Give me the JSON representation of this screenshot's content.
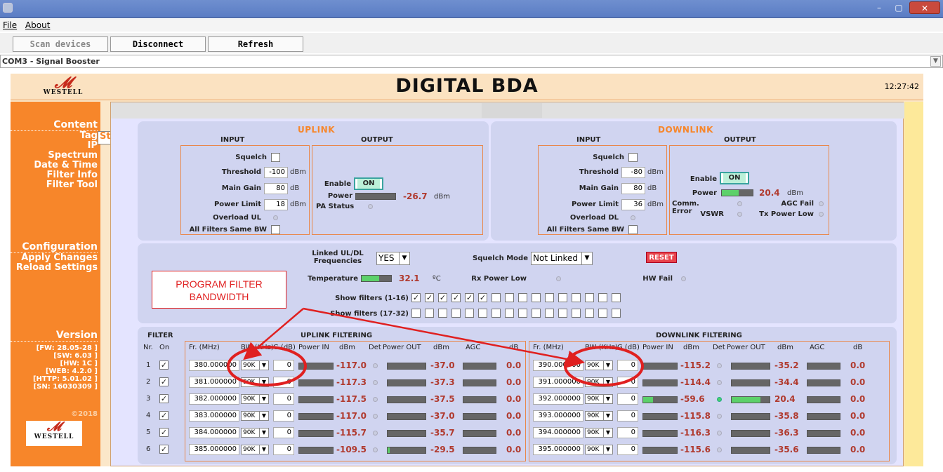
{
  "window": {
    "minimize": "–",
    "maximize": "▢",
    "close": "✕"
  },
  "menu": {
    "file": "File",
    "about": "About"
  },
  "toolbar": {
    "scan": "Scan devices",
    "disconnect": "Disconnect",
    "refresh": "Refresh"
  },
  "device": {
    "selected": "COM3 - Signal Booster"
  },
  "header": {
    "title": "DIGITAL BDA",
    "clock": "12:27:42",
    "logo": "WESTELL"
  },
  "sidebar": {
    "content_heading": "Content",
    "content_items": [
      "Status",
      "Tag",
      "IP",
      "Spectrum",
      "Date & Time",
      "Filter Info",
      "Filter Tool"
    ],
    "config_heading": "Configuration",
    "config_items": [
      "Apply Changes",
      "Reload Settings"
    ],
    "version_heading": "Version",
    "versions": [
      "[FW: 28.05-28 ]",
      "[SW: 6.03 ]",
      "[HW:  1C ]",
      "[WEB: 4.2.0 ]",
      "[HTTP: 5.01.02 ]",
      "[SN: 16030309 ]"
    ],
    "copyright": "©2018",
    "logo": "WESTELL"
  },
  "uplink": {
    "title": "UPLINK",
    "input": "INPUT",
    "output": "OUTPUT",
    "squelch": "Squelch",
    "threshold": "Threshold",
    "threshold_val": "-100",
    "threshold_unit": "dBm",
    "main_gain": "Main Gain",
    "main_gain_val": "80",
    "main_gain_unit": "dB",
    "power_limit": "Power Limit",
    "power_limit_val": "18",
    "power_limit_unit": "dBm",
    "overload": "Overload UL",
    "all_filters": "All Filters Same BW",
    "enable": "Enable",
    "on": "ON",
    "power": "Power",
    "power_val": "-26.7",
    "power_unit": "dBm",
    "pa_status": "PA Status"
  },
  "downlink": {
    "title": "DOWNLINK",
    "input": "INPUT",
    "output": "OUTPUT",
    "squelch": "Squelch",
    "threshold": "Threshold",
    "threshold_val": "-80",
    "threshold_unit": "dBm",
    "main_gain": "Main Gain",
    "main_gain_val": "80",
    "main_gain_unit": "dB",
    "power_limit": "Power Limit",
    "power_limit_val": "36",
    "power_limit_unit": "dBm",
    "overload": "Overload DL",
    "all_filters": "All Filters Same BW",
    "enable": "Enable",
    "on": "ON",
    "power": "Power",
    "power_val": "20.4",
    "power_unit": "dBm",
    "power_level": 0.55,
    "comm_error": "Comm. Error",
    "agc_fail": "AGC Fail",
    "vswr": "VSWR",
    "tx_power_low": "Tx Power Low"
  },
  "config": {
    "linked_label_1": "Linked UL/DL",
    "linked_label_2": "Frequencies",
    "linked_val": "YES",
    "squelch_mode": "Squelch Mode",
    "squelch_mode_val": "Not Linked",
    "reset": "RESET",
    "temperature": "Temperature",
    "temperature_val": "32.1",
    "temperature_unit": "ºC",
    "temperature_level": 0.6,
    "rx_power_low": "Rx Power Low",
    "hw_fail": "HW Fail",
    "show_1_16": "Show filters (1-16)",
    "show_17_32": "Show filters (17-32)",
    "checked_1_16": 6
  },
  "callout": {
    "line1": "PROGRAM FILTER",
    "line2": "BANDWIDTH"
  },
  "filter": {
    "heading": "FILTER",
    "nr": "Nr.",
    "on": "On",
    "uplink_heading": "UPLINK FILTERING",
    "downlink_heading": "DOWNLINK FILTERING",
    "columns": {
      "fr": "Fr. (MHz)",
      "bw": "BW (KHz)",
      "g": "G (dB)",
      "power_in": "Power IN",
      "dbm": "dBm",
      "det": "Det",
      "power_out": "Power OUT",
      "dbm2": "dBm",
      "agc": "AGC",
      "db": "dB"
    },
    "rows": [
      {
        "nr": "1",
        "ul": {
          "fr": "380.000000",
          "bw": "90K",
          "g": "0",
          "pin": "-117.0",
          "pout": "-37.0",
          "agc": "0.0",
          "pin_level": 0,
          "pout_level": 0
        },
        "dl": {
          "fr": "390.000000",
          "bw": "90K",
          "g": "0",
          "pin": "-115.2",
          "pout": "-35.2",
          "agc": "0.0",
          "pin_level": 0,
          "pout_level": 0
        }
      },
      {
        "nr": "2",
        "ul": {
          "fr": "381.000000",
          "bw": "90K",
          "g": "0",
          "pin": "-117.3",
          "pout": "-37.3",
          "agc": "0.0",
          "pin_level": 0,
          "pout_level": 0
        },
        "dl": {
          "fr": "391.000000",
          "bw": "90K",
          "g": "0",
          "pin": "-114.4",
          "pout": "-34.4",
          "agc": "0.0",
          "pin_level": 0,
          "pout_level": 0
        }
      },
      {
        "nr": "3",
        "ul": {
          "fr": "382.000000",
          "bw": "90K",
          "g": "0",
          "pin": "-117.5",
          "pout": "-37.5",
          "agc": "0.0",
          "pin_level": 0,
          "pout_level": 0
        },
        "dl": {
          "fr": "392.000000",
          "bw": "90K",
          "g": "0",
          "pin": "-59.6",
          "pout": "20.4",
          "agc": "0.0",
          "pin_level": 0.3,
          "pout_level": 0.75,
          "det_on": true
        }
      },
      {
        "nr": "4",
        "ul": {
          "fr": "383.000000",
          "bw": "90K",
          "g": "0",
          "pin": "-117.0",
          "pout": "-37.0",
          "agc": "0.0",
          "pin_level": 0,
          "pout_level": 0
        },
        "dl": {
          "fr": "393.000000",
          "bw": "90K",
          "g": "0",
          "pin": "-115.8",
          "pout": "-35.8",
          "agc": "0.0",
          "pin_level": 0,
          "pout_level": 0
        }
      },
      {
        "nr": "5",
        "ul": {
          "fr": "384.000000",
          "bw": "90K",
          "g": "0",
          "pin": "-115.7",
          "pout": "-35.7",
          "agc": "0.0",
          "pin_level": 0,
          "pout_level": 0
        },
        "dl": {
          "fr": "394.000000",
          "bw": "90K",
          "g": "0",
          "pin": "-116.3",
          "pout": "-36.3",
          "agc": "0.0",
          "pin_level": 0,
          "pout_level": 0
        }
      },
      {
        "nr": "6",
        "ul": {
          "fr": "385.000000",
          "bw": "90K",
          "g": "0",
          "pin": "-109.5",
          "pout": "-29.5",
          "agc": "0.0",
          "pin_level": 0,
          "pout_level": 0.05
        },
        "dl": {
          "fr": "395.000000",
          "bw": "90K",
          "g": "0",
          "pin": "-115.6",
          "pout": "-35.6",
          "agc": "0.0",
          "pin_level": 0,
          "pout_level": 0
        }
      }
    ]
  }
}
